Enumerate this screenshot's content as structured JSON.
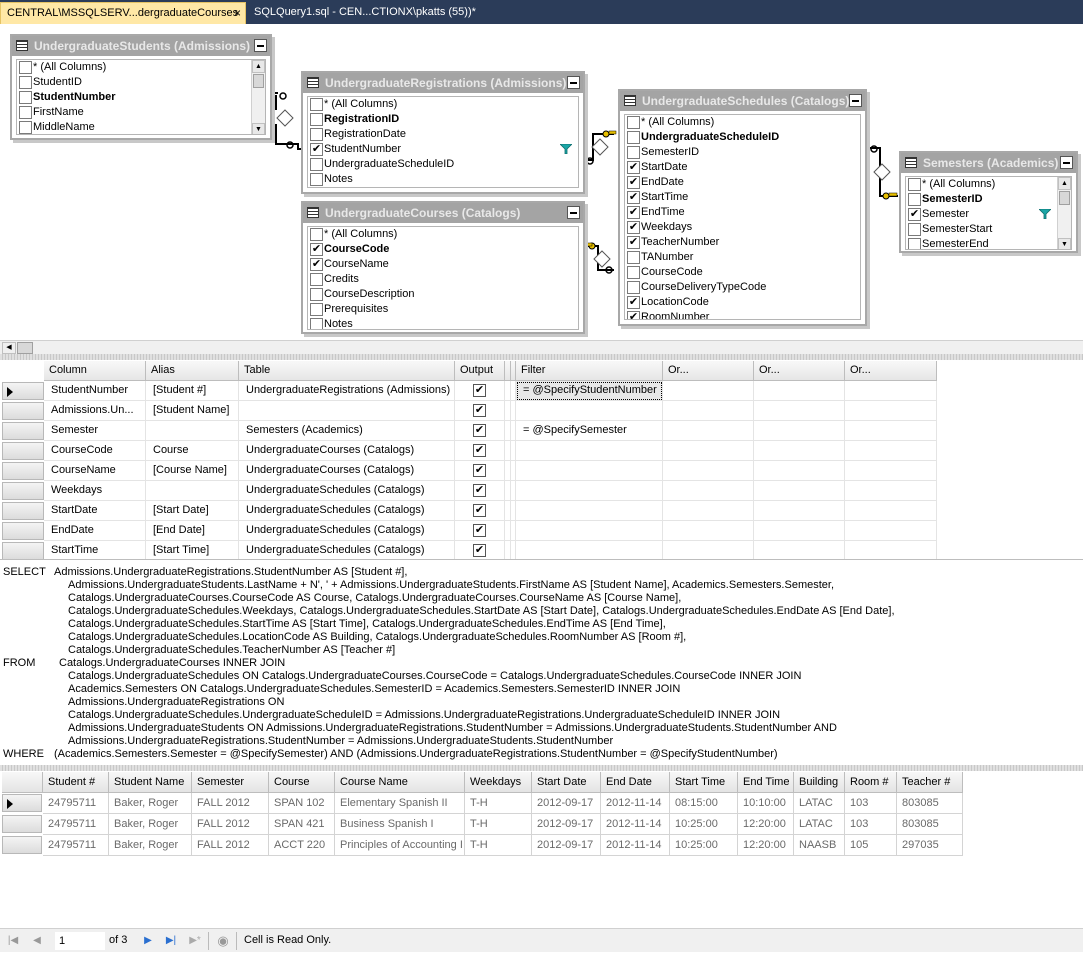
{
  "tabs": [
    {
      "label": "CENTRAL\\MSSQLSERV...dergraduateCourses",
      "close": "×"
    },
    {
      "label": "SQLQuery1.sql - CEN...CTIONX\\pkatts (55))*"
    }
  ],
  "diagram": {
    "all_columns_label": "* (All Columns)",
    "tables": [
      {
        "title": "UndergraduateStudents (Admissions)",
        "columns": [
          {
            "name": "StudentID",
            "checked": false,
            "pk": false
          },
          {
            "name": "StudentNumber",
            "checked": false,
            "pk": true
          },
          {
            "name": "FirstName",
            "checked": false,
            "pk": false
          },
          {
            "name": "MiddleName",
            "checked": false,
            "pk": false
          }
        ]
      },
      {
        "title": "UndergraduateRegistrations (Admissions)",
        "columns": [
          {
            "name": "RegistrationID",
            "checked": false,
            "pk": true
          },
          {
            "name": "RegistrationDate",
            "checked": false,
            "pk": false
          },
          {
            "name": "StudentNumber",
            "checked": true,
            "pk": false
          },
          {
            "name": "UndergraduateScheduleID",
            "checked": false,
            "pk": false
          },
          {
            "name": "Notes",
            "checked": false,
            "pk": false
          }
        ]
      },
      {
        "title": "UndergraduateCourses (Catalogs)",
        "columns": [
          {
            "name": "CourseCode",
            "checked": true,
            "pk": true
          },
          {
            "name": "CourseName",
            "checked": true,
            "pk": false
          },
          {
            "name": "Credits",
            "checked": false,
            "pk": false
          },
          {
            "name": "CourseDescription",
            "checked": false,
            "pk": false
          },
          {
            "name": "Prerequisites",
            "checked": false,
            "pk": false
          },
          {
            "name": "Notes",
            "checked": false,
            "pk": false
          }
        ]
      },
      {
        "title": "UndergraduateSchedules (Catalogs)",
        "columns": [
          {
            "name": "UndergraduateScheduleID",
            "checked": false,
            "pk": true
          },
          {
            "name": "SemesterID",
            "checked": false,
            "pk": false
          },
          {
            "name": "StartDate",
            "checked": true,
            "pk": false
          },
          {
            "name": "EndDate",
            "checked": true,
            "pk": false
          },
          {
            "name": "StartTime",
            "checked": true,
            "pk": false
          },
          {
            "name": "EndTime",
            "checked": true,
            "pk": false
          },
          {
            "name": "Weekdays",
            "checked": true,
            "pk": false
          },
          {
            "name": "TeacherNumber",
            "checked": true,
            "pk": false
          },
          {
            "name": "TANumber",
            "checked": false,
            "pk": false
          },
          {
            "name": "CourseCode",
            "checked": false,
            "pk": false
          },
          {
            "name": "CourseDeliveryTypeCode",
            "checked": false,
            "pk": false
          },
          {
            "name": "LocationCode",
            "checked": true,
            "pk": false
          },
          {
            "name": "RoomNumber",
            "checked": true,
            "pk": false
          }
        ]
      },
      {
        "title": "Semesters (Academics)",
        "columns": [
          {
            "name": "SemesterID",
            "checked": false,
            "pk": true
          },
          {
            "name": "Semester",
            "checked": true,
            "pk": false
          },
          {
            "name": "SemesterStart",
            "checked": false,
            "pk": false
          },
          {
            "name": "SemesterEnd",
            "checked": false,
            "pk": false
          }
        ]
      }
    ]
  },
  "criteria": {
    "headers": [
      "Column",
      "Alias",
      "Table",
      "Output",
      "",
      "Filter",
      "Or...",
      "Or...",
      "Or..."
    ],
    "rows": [
      {
        "column": "StudentNumber",
        "alias": "[Student #]",
        "table": "UndergraduateRegistrations (Admissions)",
        "output": true,
        "filter": "= @SpecifyStudentNumber"
      },
      {
        "column": "Admissions.Un...",
        "alias": "[Student Name]",
        "table": "",
        "output": true,
        "filter": ""
      },
      {
        "column": "Semester",
        "alias": "",
        "table": "Semesters (Academics)",
        "output": true,
        "filter": "= @SpecifySemester"
      },
      {
        "column": "CourseCode",
        "alias": "Course",
        "table": "UndergraduateCourses (Catalogs)",
        "output": true,
        "filter": ""
      },
      {
        "column": "CourseName",
        "alias": "[Course Name]",
        "table": "UndergraduateCourses (Catalogs)",
        "output": true,
        "filter": ""
      },
      {
        "column": "Weekdays",
        "alias": "",
        "table": "UndergraduateSchedules (Catalogs)",
        "output": true,
        "filter": ""
      },
      {
        "column": "StartDate",
        "alias": "[Start Date]",
        "table": "UndergraduateSchedules (Catalogs)",
        "output": true,
        "filter": ""
      },
      {
        "column": "EndDate",
        "alias": "[End Date]",
        "table": "UndergraduateSchedules (Catalogs)",
        "output": true,
        "filter": ""
      },
      {
        "column": "StartTime",
        "alias": "[Start Time]",
        "table": "UndergraduateSchedules (Catalogs)",
        "output": true,
        "filter": ""
      }
    ]
  },
  "sql": [
    {
      "kw": "SELECT",
      "text": "Admissions.UndergraduateRegistrations.StudentNumber AS [Student #],",
      "indent": 0
    },
    {
      "kw": "",
      "text": "Admissions.UndergraduateStudents.LastName + N', ' + Admissions.UndergraduateStudents.FirstName AS [Student Name], Academics.Semesters.Semester,",
      "indent": 1
    },
    {
      "kw": "",
      "text": "Catalogs.UndergraduateCourses.CourseCode AS Course, Catalogs.UndergraduateCourses.CourseName AS [Course Name],",
      "indent": 2
    },
    {
      "kw": "",
      "text": "Catalogs.UndergraduateSchedules.Weekdays, Catalogs.UndergraduateSchedules.StartDate AS [Start Date], Catalogs.UndergraduateSchedules.EndDate AS [End Date],",
      "indent": 2
    },
    {
      "kw": "",
      "text": "Catalogs.UndergraduateSchedules.StartTime AS [Start Time], Catalogs.UndergraduateSchedules.EndTime AS [End Time],",
      "indent": 2
    },
    {
      "kw": "",
      "text": "Catalogs.UndergraduateSchedules.LocationCode AS Building, Catalogs.UndergraduateSchedules.RoomNumber AS [Room #],",
      "indent": 2
    },
    {
      "kw": "",
      "text": "Catalogs.UndergraduateSchedules.TeacherNumber AS [Teacher #]",
      "indent": 2
    },
    {
      "kw": "FROM",
      "text": "Catalogs.UndergraduateCourses INNER JOIN",
      "indent": 3
    },
    {
      "kw": "",
      "text": "Catalogs.UndergraduateSchedules ON Catalogs.UndergraduateCourses.CourseCode = Catalogs.UndergraduateSchedules.CourseCode INNER JOIN",
      "indent": 2
    },
    {
      "kw": "",
      "text": "Academics.Semesters ON Catalogs.UndergraduateSchedules.SemesterID = Academics.Semesters.SemesterID INNER JOIN",
      "indent": 2
    },
    {
      "kw": "",
      "text": "Admissions.UndergraduateRegistrations ON",
      "indent": 2
    },
    {
      "kw": "",
      "text": "Catalogs.UndergraduateSchedules.UndergraduateScheduleID = Admissions.UndergraduateRegistrations.UndergraduateScheduleID INNER JOIN",
      "indent": 2
    },
    {
      "kw": "",
      "text": "Admissions.UndergraduateStudents ON Admissions.UndergraduateRegistrations.StudentNumber = Admissions.UndergraduateStudents.StudentNumber AND",
      "indent": 2
    },
    {
      "kw": "",
      "text": "Admissions.UndergraduateRegistrations.StudentNumber = Admissions.UndergraduateStudents.StudentNumber",
      "indent": 2
    },
    {
      "kw": "WHERE",
      "text": "(Academics.Semesters.Semester = @SpecifySemester) AND (Admissions.UndergraduateRegistrations.StudentNumber = @SpecifyStudentNumber)",
      "indent": 4
    }
  ],
  "results": {
    "headers": [
      "Student #",
      "Student Name",
      "Semester",
      "Course",
      "Course Name",
      "Weekdays",
      "Start Date",
      "End Date",
      "Start Time",
      "End Time",
      "Building",
      "Room #",
      "Teacher #"
    ],
    "rows": [
      [
        "24795711",
        "Baker, Roger",
        "FALL 2012",
        "SPAN 102",
        "Elementary Spanish II",
        "T-H",
        "2012-09-17",
        "2012-11-14",
        "08:15:00",
        "10:10:00",
        "LATAC",
        "103",
        "803085"
      ],
      [
        "24795711",
        "Baker, Roger",
        "FALL 2012",
        "SPAN 421",
        "Business Spanish I",
        "T-H",
        "2012-09-17",
        "2012-11-14",
        "10:25:00",
        "12:20:00",
        "LATAC",
        "103",
        "803085"
      ],
      [
        "24795711",
        "Baker, Roger",
        "FALL 2012",
        "ACCT 220",
        "Principles of Accounting I",
        "T-H",
        "2012-09-17",
        "2012-11-14",
        "10:25:00",
        "12:20:00",
        "NAASB",
        "105",
        "297035"
      ]
    ]
  },
  "nav": {
    "page": "1",
    "of_label": "of 3",
    "status": "Cell is Read Only."
  },
  "icons": {
    "table": "table-icon",
    "filter": "filter-funnel-icon",
    "key": "key-icon",
    "join": "join-diamond-icon"
  },
  "colors": {
    "tabbar": "#2b3c59",
    "active_tab": "#ffe8a6",
    "table_title": "#a4a4a4",
    "filter_icon": "#1aa6a6",
    "key_icon": "#e8c000"
  }
}
